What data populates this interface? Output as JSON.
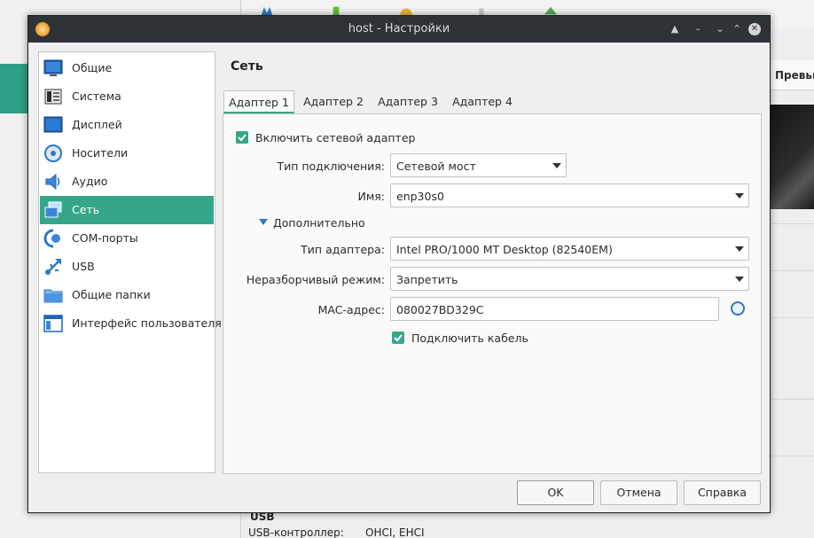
{
  "background": {
    "preview_label": "Превью",
    "usb_title": "USB",
    "usb_controller_label": "USB-контроллер:",
    "usb_controller_value": "OHCI, EHCI"
  },
  "dialog": {
    "title": "host - Настройки",
    "window_controls": [
      "minimize",
      "restore",
      "maximize",
      "close"
    ]
  },
  "sidebar": {
    "items": [
      {
        "label": "Общие",
        "icon": "general-icon"
      },
      {
        "label": "Система",
        "icon": "system-icon"
      },
      {
        "label": "Дисплей",
        "icon": "display-icon"
      },
      {
        "label": "Носители",
        "icon": "storage-icon"
      },
      {
        "label": "Аудио",
        "icon": "audio-icon"
      },
      {
        "label": "Сеть",
        "icon": "network-icon",
        "active": true
      },
      {
        "label": "COM-порты",
        "icon": "serial-port-icon"
      },
      {
        "label": "USB",
        "icon": "usb-icon"
      },
      {
        "label": "Общие папки",
        "icon": "shared-folder-icon"
      },
      {
        "label": "Интерфейс пользователя",
        "icon": "user-interface-icon"
      }
    ]
  },
  "page": {
    "title": "Сеть",
    "tabs": [
      "Адаптер 1",
      "Адаптер 2",
      "Адаптер 3",
      "Адаптер 4"
    ],
    "active_tab": "Адаптер 1"
  },
  "adapter": {
    "enable_label": "Включить сетевой адаптер",
    "enabled": true,
    "attached_label": "Тип подключения:",
    "attached_value": "Сетевой мост",
    "name_label": "Имя:",
    "name_value": "enp30s0",
    "advanced_label": "Дополнительно",
    "adapter_type_label": "Тип адаптера:",
    "adapter_type_value": "Intel PRO/1000 MT Desktop (82540EM)",
    "promiscuous_label": "Неразборчивый режим:",
    "promiscuous_value": "Запретить",
    "mac_label": "MAC-адрес:",
    "mac_value": "080027BD329C",
    "cable_label": "Подключить кабель",
    "cable_connected": true
  },
  "buttons": {
    "ok": "OK",
    "cancel": "Отмена",
    "help": "Справка"
  },
  "colors": {
    "accent": "#36a688",
    "titlebar": "#2f3237",
    "link_blue": "#2d77c7"
  }
}
